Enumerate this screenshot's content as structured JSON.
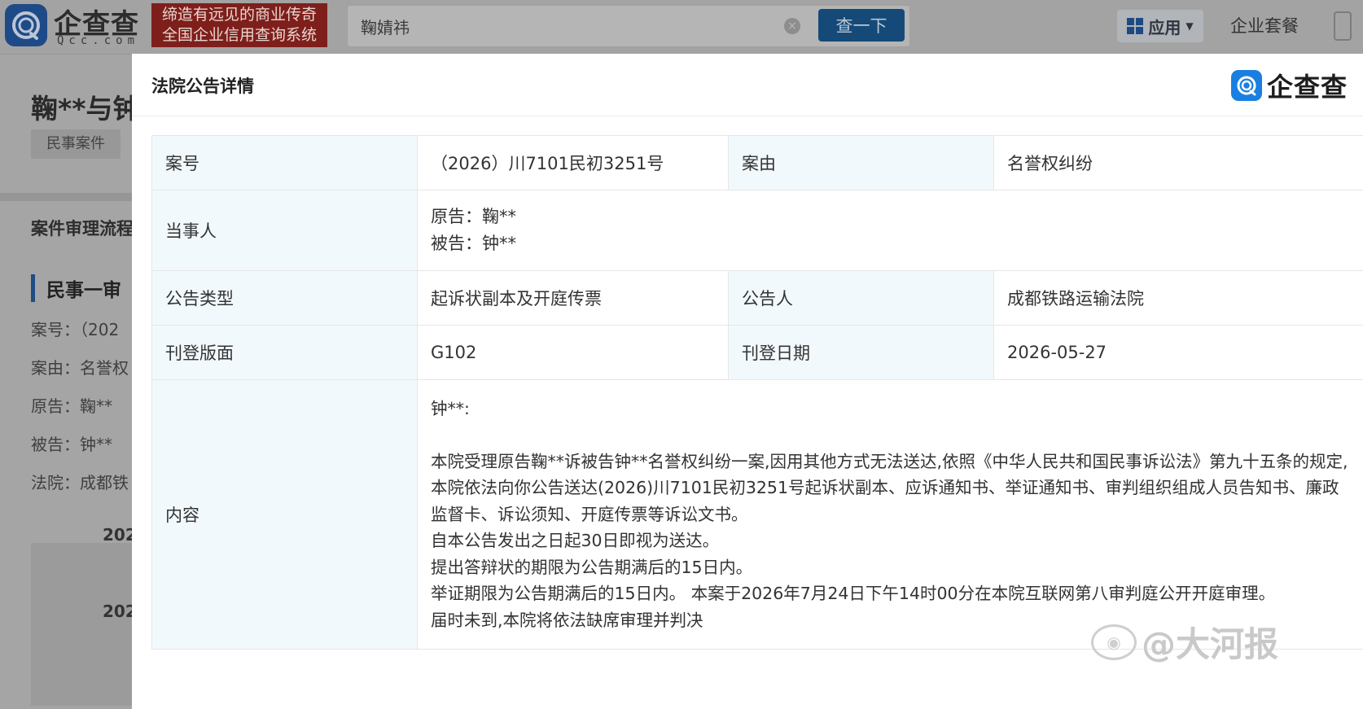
{
  "header": {
    "logo_text": "企查查",
    "logo_sub": "Qcc.com",
    "slogan_line1": "缔造有远见的商业传奇",
    "slogan_line2": "全国企业信用查询系统",
    "search_value": "鞠婧祎",
    "search_button": "查一下",
    "apps_label": "应用",
    "package_label": "企业套餐"
  },
  "background": {
    "title": "鞠**与钟",
    "tag": "民事案件",
    "section_title": "案件审理流程",
    "stage": "民事一审",
    "lines": [
      "案号：（202",
      "案由：名誉权",
      "原告：鞠**",
      "被告：钟**",
      "法院：成都铁"
    ],
    "years": [
      "202",
      "202"
    ]
  },
  "modal": {
    "title": "法院公告详情",
    "brand": "企查查",
    "rows": {
      "case_no_label": "案号",
      "case_no_value": "（2026）川7101民初3251号",
      "cause_label": "案由",
      "cause_value": "名誉权纠纷",
      "parties_label": "当事人",
      "plaintiff": "原告：鞠**",
      "defendant": "被告：钟**",
      "notice_type_label": "公告类型",
      "notice_type_value": "起诉状副本及开庭传票",
      "announcer_label": "公告人",
      "announcer_value": "成都铁路运输法院",
      "page_label": "刊登版面",
      "page_value": "G102",
      "date_label": "刊登日期",
      "date_value": "2026-05-27",
      "content_label": "内容",
      "content_greeting": "钟**:",
      "content_para1": "本院受理原告鞠**诉被告钟**名誉权纠纷一案,因用其他方式无法送达,依照《中华人民共和国民事诉讼法》第九十五条的规定,本院依法向你公告送达(2026)川7101民初3251号起诉状副本、应诉通知书、举证通知书、审判组织组成人员告知书、廉政监督卡、诉讼须知、开庭传票等诉讼文书。",
      "content_line2": "自本公告发出之日起30日即视为送达。",
      "content_line3": "提出答辩状的期限为公告期满后的15日内。",
      "content_line4": "举证期限为公告期满后的15日内。 本案于2026年7月24日下午14时00分在本院互联网第八审判庭公开开庭审理。",
      "content_line5": "届时未到,本院将依法缺席审理并判决"
    }
  },
  "watermark": "@大河报",
  "colors": {
    "link_blue": "#1a80d6",
    "label_bg": "#f2f9fc",
    "brand_blue": "#1a7fe0",
    "slogan_red": "#7e1f1c"
  }
}
